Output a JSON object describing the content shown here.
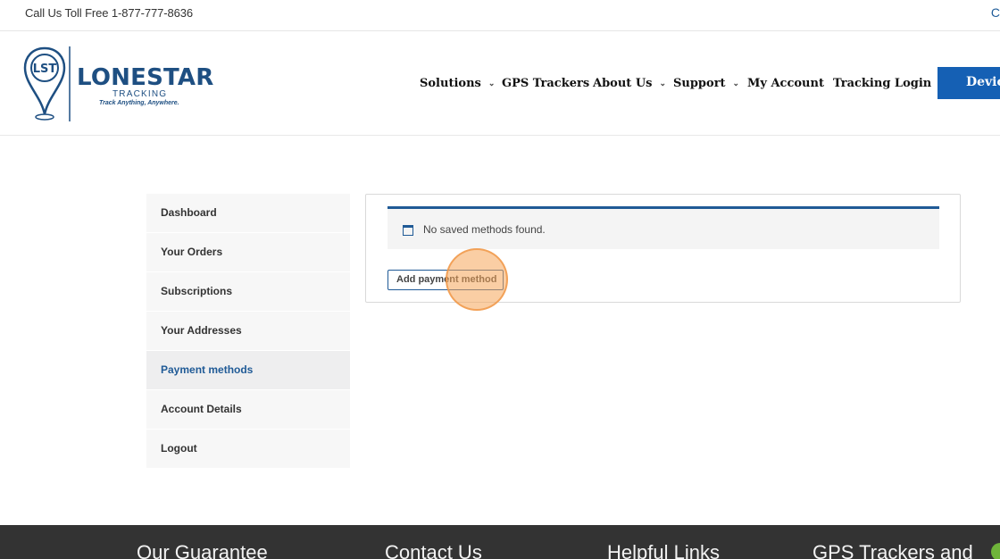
{
  "topbar": {
    "phone": "Call Us Toll Free 1-877-777-8636",
    "right_fragment": "C"
  },
  "logo": {
    "brand": "LONESTAR",
    "sub": "TRACKING",
    "tagline": "Track Anything, Anywhere.",
    "initials": "LST"
  },
  "nav": {
    "items": [
      {
        "label": "Solutions",
        "has_dropdown": true
      },
      {
        "label": "GPS Trackers",
        "has_dropdown": false
      },
      {
        "label": "About Us",
        "has_dropdown": true
      },
      {
        "label": "Support",
        "has_dropdown": true
      },
      {
        "label": "My Account",
        "has_dropdown": false
      },
      {
        "label": "Tracking Login",
        "has_dropdown": false
      }
    ],
    "cta_label": "Device"
  },
  "account_nav": {
    "items": [
      {
        "label": "Dashboard",
        "active": false
      },
      {
        "label": "Your Orders",
        "active": false
      },
      {
        "label": "Subscriptions",
        "active": false
      },
      {
        "label": "Your Addresses",
        "active": false
      },
      {
        "label": "Payment methods",
        "active": true
      },
      {
        "label": "Account Details",
        "active": false
      },
      {
        "label": "Logout",
        "active": false
      }
    ]
  },
  "payment": {
    "notice": "No saved methods found.",
    "add_button": "Add payment method"
  },
  "footer": {
    "headings": [
      "Our Guarantee",
      "Contact Us",
      "Helpful Links",
      "GPS Trackers and"
    ]
  },
  "colors": {
    "brand_blue": "#1e4f82",
    "accent": "#1f5a96",
    "cta": "#1560b4",
    "footer_bg": "#333333"
  }
}
